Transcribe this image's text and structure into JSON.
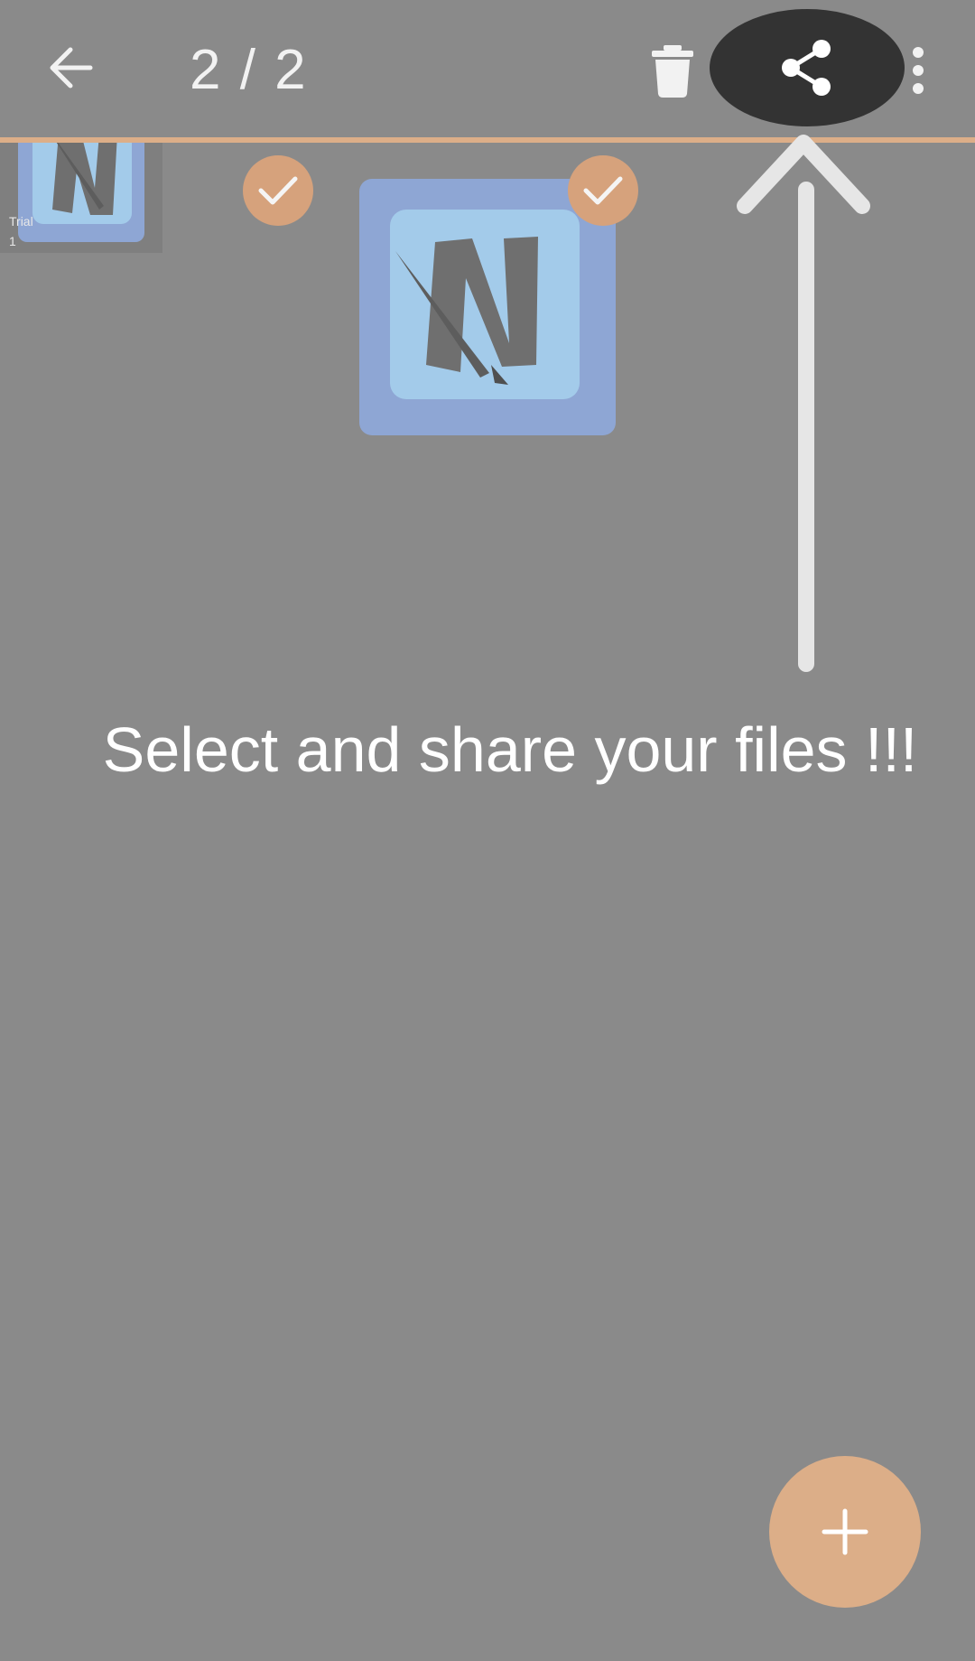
{
  "toolbar": {
    "counter": "2 / 2",
    "back_icon": "arrow-back-icon",
    "delete_icon": "trash-icon",
    "share_icon": "share-icon",
    "more_icon": "more-vertical-icon"
  },
  "grid": {
    "items": [
      {
        "caption_line1": "Trial",
        "caption_line2": "1",
        "selected": true
      },
      {
        "selected": true
      }
    ]
  },
  "tutorial": {
    "text": "Select and share your files !!!"
  },
  "fab": {
    "label": "+",
    "icon": "plus-icon"
  },
  "colors": {
    "overlay_gray": "#8a8a8a",
    "accent": "#dcae88",
    "highlight": "#333333",
    "app_icon_blue": "#a3cbea"
  }
}
